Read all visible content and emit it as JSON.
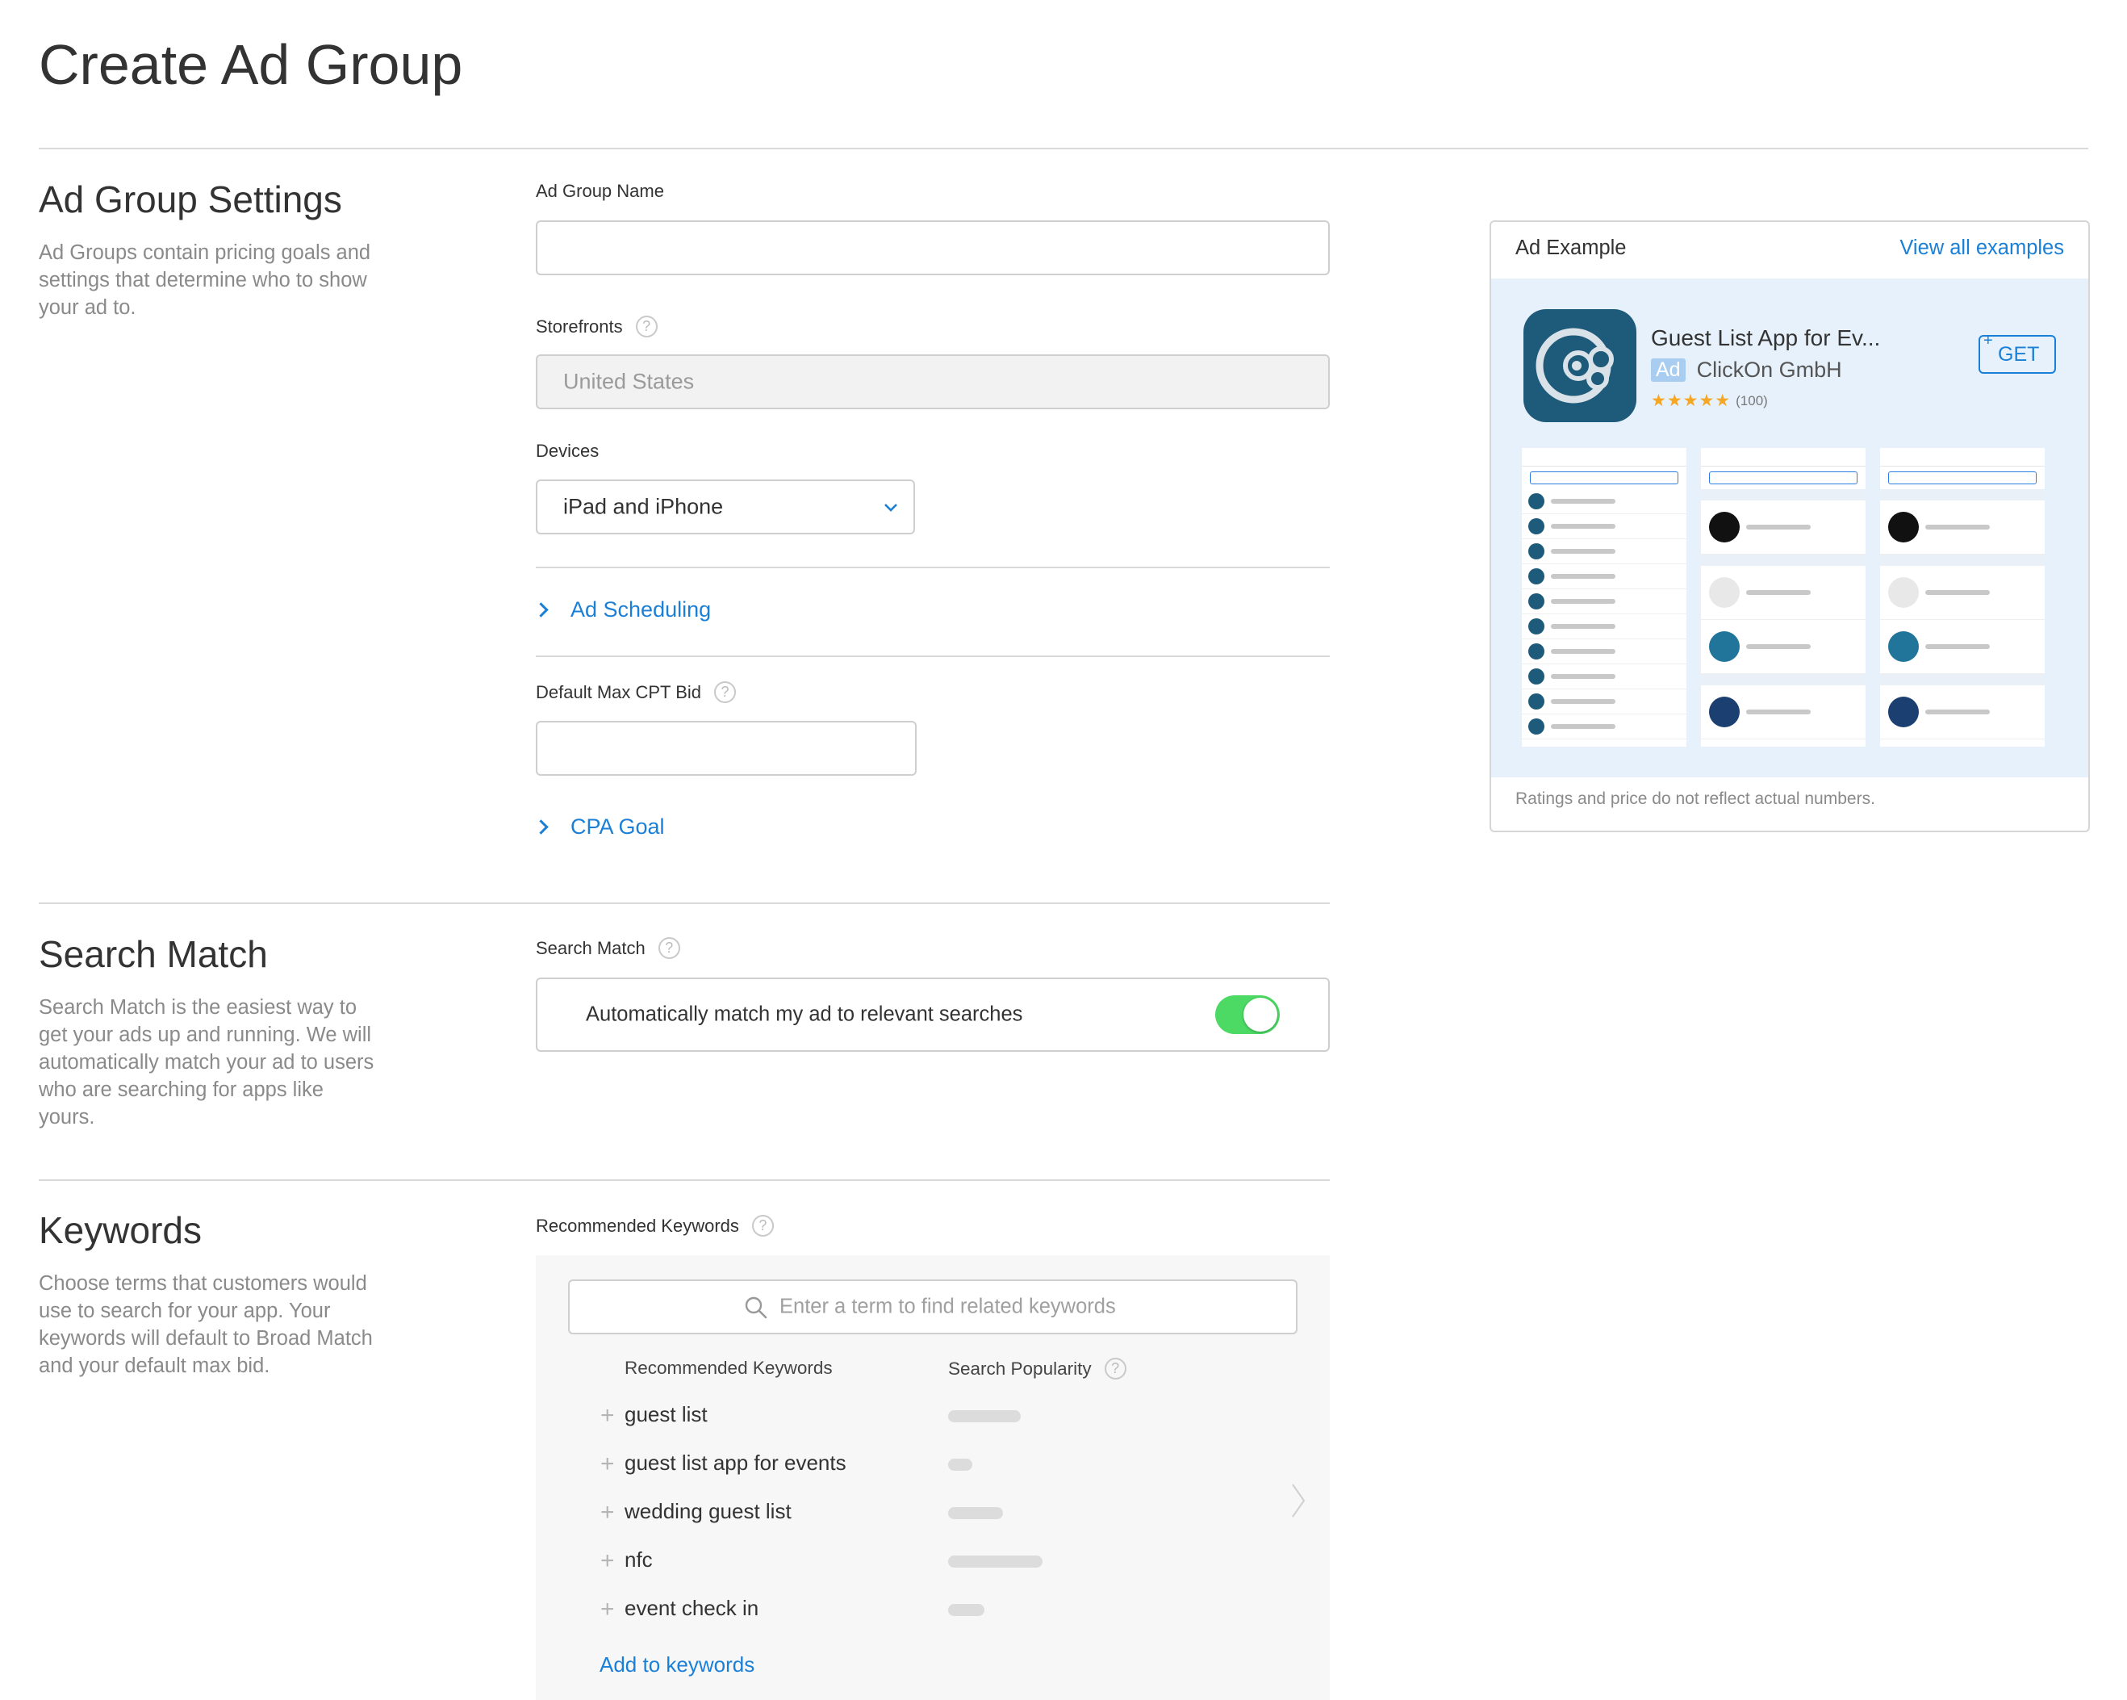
{
  "page": {
    "title": "Create Ad Group"
  },
  "ad_group_settings": {
    "title": "Ad Group Settings",
    "description": "Ad Groups contain pricing goals and settings that determine who to show your ad to.",
    "name_label": "Ad Group Name",
    "storefronts_label": "Storefronts",
    "storefronts_value": "United States",
    "devices_label": "Devices",
    "devices_value": "iPad and iPhone",
    "ad_scheduling_label": "Ad Scheduling",
    "default_bid_label": "Default Max CPT Bid",
    "cpa_goal_label": "CPA Goal",
    "help_glyph": "?"
  },
  "search_match": {
    "title": "Search Match",
    "description": "Search Match is the easiest way to get your ads up and running. We will automatically match your ad to users who are searching for apps like yours.",
    "label": "Search Match",
    "toggle_text": "Automatically match my ad to relevant searches",
    "enabled": true
  },
  "keywords": {
    "title": "Keywords",
    "description": "Choose terms that customers would use to search for your app. Your keywords will default to Broad Match and your default max bid.",
    "label": "Recommended Keywords",
    "search_placeholder": "Enter a term to find related keywords",
    "col_keywords": "Recommended Keywords",
    "col_popularity": "Search Popularity",
    "plus_glyph": "+",
    "items": [
      {
        "text": "guest list",
        "popularity": 0.6
      },
      {
        "text": "guest list app for events",
        "popularity": 0.2
      },
      {
        "text": "wedding guest list",
        "popularity": 0.45
      },
      {
        "text": "nfc",
        "popularity": 0.78
      },
      {
        "text": "event check in",
        "popularity": 0.3
      }
    ],
    "add_link": "Add to keywords"
  },
  "ad_example": {
    "title": "Ad Example",
    "view_all": "View all examples",
    "app_name": "Guest List App for Ev...",
    "badge": "Ad",
    "developer": "ClickOn GmbH",
    "stars": "★★★★★",
    "rating_count": "(100)",
    "get_button": "GET",
    "get_plus": "+",
    "disclaimer": "Ratings and price do not reflect actual numbers.",
    "colors": {
      "accent": "#1a7fd6",
      "icon_bg": "#1e5a79",
      "preview_bg": "#e6f1fb",
      "toggle_on": "#4cd964",
      "star": "#f5a623"
    }
  }
}
